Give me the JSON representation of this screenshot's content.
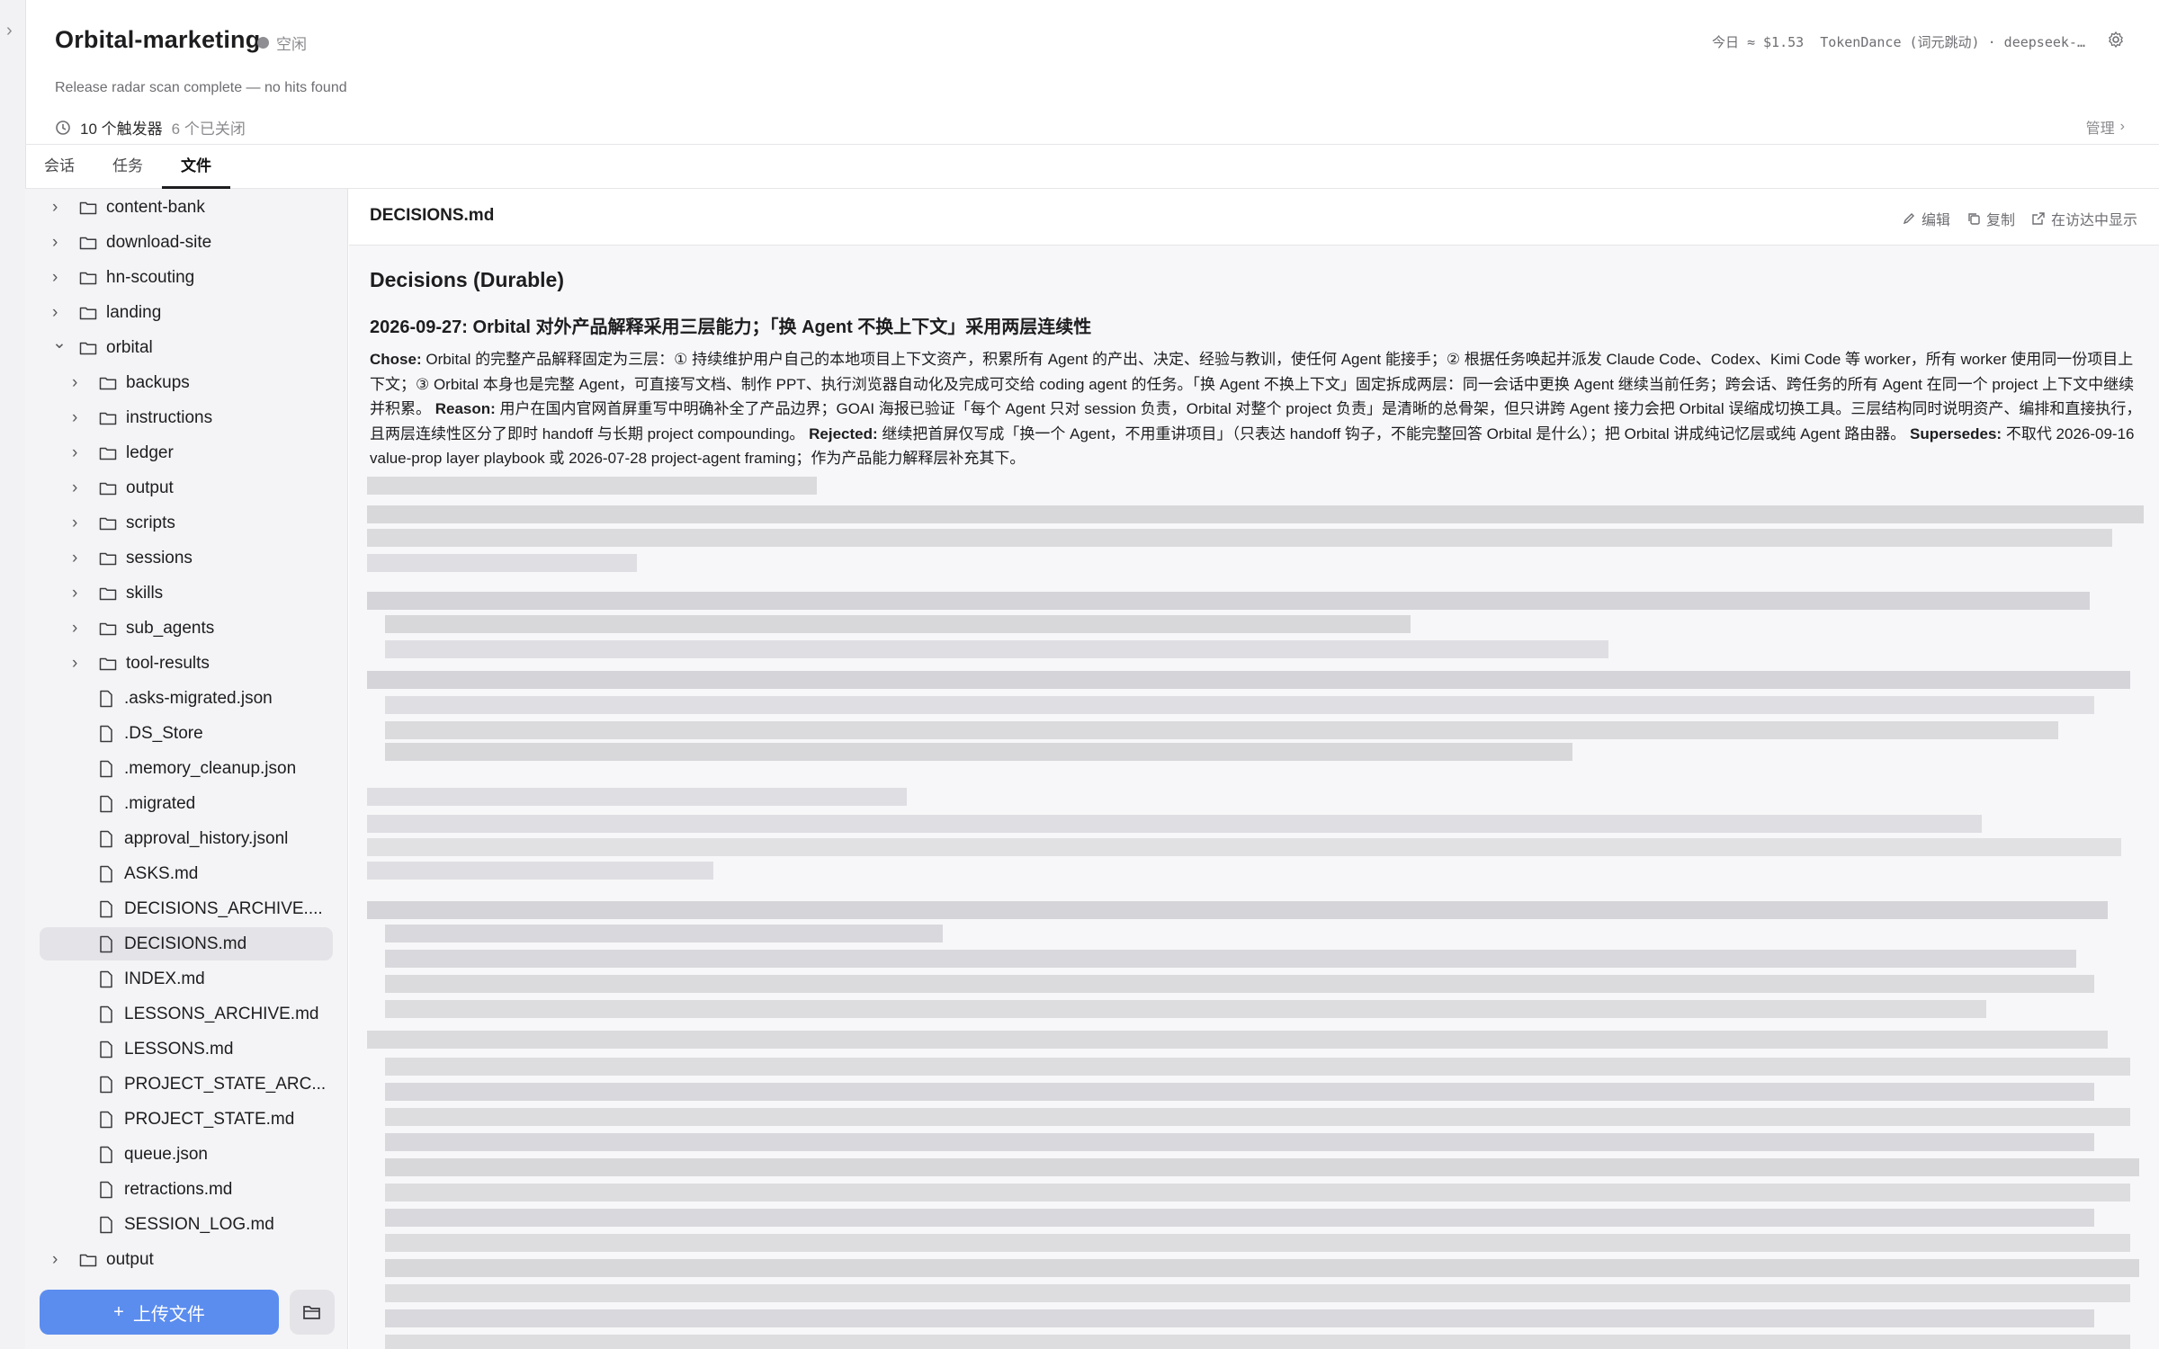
{
  "header": {
    "title": "Orbital-marketing",
    "status": "空闲",
    "subtitle": "Release radar scan complete — no hits found",
    "triggers": "10 个触发器",
    "triggers_closed": "6 个已关闭",
    "cost": "今日 ≈ $1.53",
    "provider": "TokenDance (词元跳动) · deepseek-…",
    "manage": "管理"
  },
  "tabs": [
    "会话",
    "任务",
    "文件"
  ],
  "tree": [
    {
      "label": "content-bank",
      "type": "folder",
      "level": 0,
      "expanded": false
    },
    {
      "label": "download-site",
      "type": "folder",
      "level": 0,
      "expanded": false
    },
    {
      "label": "hn-scouting",
      "type": "folder",
      "level": 0,
      "expanded": false
    },
    {
      "label": "landing",
      "type": "folder",
      "level": 0,
      "expanded": false
    },
    {
      "label": "orbital",
      "type": "folder",
      "level": 0,
      "expanded": true
    },
    {
      "label": "backups",
      "type": "folder",
      "level": 1,
      "expanded": false
    },
    {
      "label": "instructions",
      "type": "folder",
      "level": 1,
      "expanded": false
    },
    {
      "label": "ledger",
      "type": "folder",
      "level": 1,
      "expanded": false
    },
    {
      "label": "output",
      "type": "folder",
      "level": 1,
      "expanded": false
    },
    {
      "label": "scripts",
      "type": "folder",
      "level": 1,
      "expanded": false
    },
    {
      "label": "sessions",
      "type": "folder",
      "level": 1,
      "expanded": false
    },
    {
      "label": "skills",
      "type": "folder",
      "level": 1,
      "expanded": false
    },
    {
      "label": "sub_agents",
      "type": "folder",
      "level": 1,
      "expanded": false
    },
    {
      "label": "tool-results",
      "type": "folder",
      "level": 1,
      "expanded": false
    },
    {
      "label": ".asks-migrated.json",
      "type": "file",
      "level": 1
    },
    {
      "label": ".DS_Store",
      "type": "file",
      "level": 1
    },
    {
      "label": ".memory_cleanup.json",
      "type": "file",
      "level": 1
    },
    {
      "label": ".migrated",
      "type": "file",
      "level": 1
    },
    {
      "label": "approval_history.jsonl",
      "type": "file",
      "level": 1
    },
    {
      "label": "ASKS.md",
      "type": "file",
      "level": 1
    },
    {
      "label": "DECISIONS_ARCHIVE....",
      "type": "file",
      "level": 1
    },
    {
      "label": "DECISIONS.md",
      "type": "file",
      "level": 1,
      "selected": true
    },
    {
      "label": "INDEX.md",
      "type": "file",
      "level": 1
    },
    {
      "label": "LESSONS_ARCHIVE.md",
      "type": "file",
      "level": 1
    },
    {
      "label": "LESSONS.md",
      "type": "file",
      "level": 1
    },
    {
      "label": "PROJECT_STATE_ARC...",
      "type": "file",
      "level": 1
    },
    {
      "label": "PROJECT_STATE.md",
      "type": "file",
      "level": 1
    },
    {
      "label": "queue.json",
      "type": "file",
      "level": 1
    },
    {
      "label": "retractions.md",
      "type": "file",
      "level": 1
    },
    {
      "label": "SESSION_LOG.md",
      "type": "file",
      "level": 1
    },
    {
      "label": "output",
      "type": "folder",
      "level": 0,
      "expanded": false
    }
  ],
  "upload_label": "上传文件",
  "file": {
    "name": "DECISIONS.md",
    "actions": {
      "edit": "编辑",
      "copy": "复制",
      "reveal": "在访达中显示"
    },
    "h1": "Decisions (Durable)",
    "h2": "2026-09-27: Orbital 对外产品解释采用三层能力；「换 Agent 不换上下文」采用两层连续性",
    "chose_label": "Chose:",
    "chose": " Orbital 的完整产品解释固定为三层：① 持续维护用户自己的本地项目上下文资产，积累所有 Agent 的产出、决定、经验与教训，使任何 Agent 能接手；② 根据任务唤起并派发 Claude Code、Codex、Kimi Code 等 worker，所有 worker 使用同一份项目上下文；③ Orbital 本身也是完整 Agent，可直接写文档、制作 PPT、执行浏览器自动化及完成可交给 coding agent 的任务。「换 Agent 不换上下文」固定拆成两层：同一会话中更换 Agent 继续当前任务；跨会话、跨任务的所有 Agent 在同一个 project 上下文中继续并积累。",
    "reason_label": "Reason:",
    "reason": " 用户在国内官网首屏重写中明确补全了产品边界；GOAI 海报已验证「每个 Agent 只对 session 负责，Orbital 对整个 project 负责」是清晰的总骨架，但只讲跨 Agent 接力会把 Orbital 误缩成切换工具。三层结构同时说明资产、编排和直接执行，且两层连续性区分了即时 handoff 与长期 project compounding。",
    "rejected_label": "Rejected:",
    "rejected": " 继续把首屏仅写成「换一个 Agent，不用重讲项目」（只表达 handoff 钩子，不能完整回答 Orbital 是什么）；把 Orbital 讲成纯记忆层或纯 Agent 路由器。",
    "supersedes_label": "Supersedes:",
    "supersedes": " 不取代 2026-09-16 value-prop layer playbook 或 2026-07-28 project-agent framing；作为产品能力解释层补充其下。"
  },
  "colors": {
    "accent": "#5b8def",
    "sidebar_bg": "#f4f4f6",
    "main_bg": "#f7f7f9",
    "selected_bg": "#e4e4e8"
  }
}
